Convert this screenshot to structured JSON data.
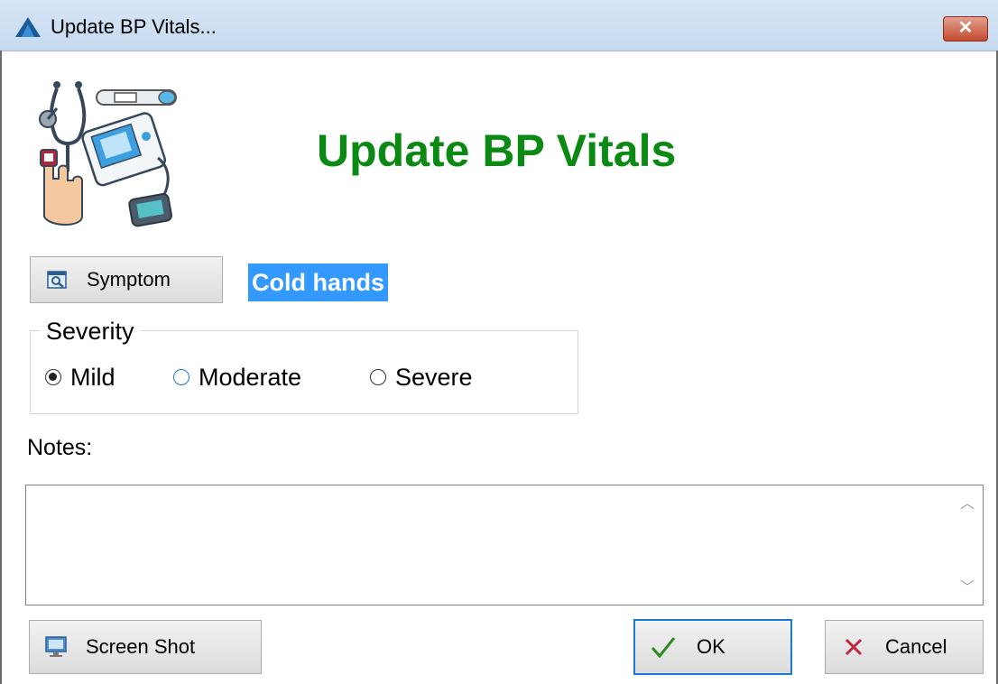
{
  "window": {
    "title": "Update BP Vitals...",
    "close_glyph": "✕",
    "icon": "app-logo-icon"
  },
  "header": {
    "heading": "Update BP Vitals",
    "heading_color": "#0a8a12",
    "illustration": "medical-devices-illustration"
  },
  "symptom": {
    "button_label": "Symptom",
    "button_icon": "symptom-lookup-icon",
    "value": "Cold hands",
    "selection_color": "#3399ff"
  },
  "severity": {
    "label": "Severity",
    "options": [
      {
        "label": "Mild",
        "checked": true
      },
      {
        "label": "Moderate",
        "checked": false
      },
      {
        "label": "Severe",
        "checked": false
      }
    ]
  },
  "notes": {
    "label": "Notes:",
    "value": ""
  },
  "footer": {
    "screenshot_label": "Screen Shot",
    "ok_label": "OK",
    "cancel_label": "Cancel",
    "ok_focus_color": "#1e78d7"
  }
}
